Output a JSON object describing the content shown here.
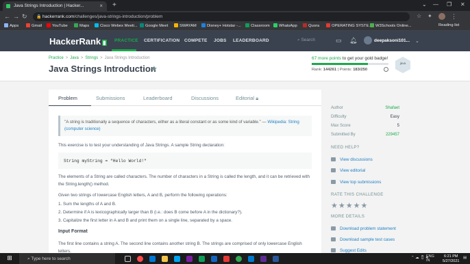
{
  "browser": {
    "tab_title": "Java Strings Introduction | Hacker...",
    "url_host": "hackerrank.com",
    "url_path": "/challenges/java-strings-introduction/problem",
    "bookmarks": [
      {
        "label": "Apps",
        "color": "#8ab4f8"
      },
      {
        "label": "Gmail",
        "color": "#ea4335"
      },
      {
        "label": "YouTube",
        "color": "#ff0000"
      },
      {
        "label": "Maps",
        "color": "#34a853"
      },
      {
        "label": "Cisco Webex Meeti...",
        "color": "#00bceb"
      },
      {
        "label": "Google Meet",
        "color": "#00897b"
      },
      {
        "label": "SWAYAM",
        "color": "#f4b400"
      },
      {
        "label": "Disney+ Hotstar -...",
        "color": "#1f80e0"
      },
      {
        "label": "Classroom",
        "color": "#0f9d58"
      },
      {
        "label": "WhatsApp",
        "color": "#25d366"
      },
      {
        "label": "Quora",
        "color": "#b92b27"
      },
      {
        "label": "OPERATING SYSTE...",
        "color": "#e53935"
      },
      {
        "label": "W3Schools Online...",
        "color": "#4caf50"
      }
    ],
    "reading_list": "Reading list"
  },
  "nav": {
    "logo": "HackerRank",
    "links": [
      "PRACTICE",
      "CERTIFICATION",
      "COMPETE",
      "JOBS",
      "LEADERBOARD"
    ],
    "search_placeholder": "Search",
    "username": "deepaksoni101..."
  },
  "header": {
    "breadcrumb": [
      "Practice",
      "Java",
      "Strings",
      "Java Strings Introduction"
    ],
    "title": "Java Strings Introduction",
    "points_more": "67 more points",
    "points_rest": " to get your gold badge!",
    "progress": 0.73,
    "rank_label": "Rank: ",
    "rank": "144261",
    "points_label": "Points: ",
    "points": "183/250",
    "badge_text": "java"
  },
  "tabs": [
    "Problem",
    "Submissions",
    "Leaderboard",
    "Discussions",
    "Editorial"
  ],
  "problem": {
    "quote_text": "\"A string is traditionally a sequence of characters, either as a literal constant or as some kind of variable.\" — ",
    "quote_link": "Wikipedia: String (computer science)",
    "intro": "This exercise is to test your understanding of Java Strings. A sample String declaration:",
    "code": "String myString = \"Hello World!\"",
    "para1": "The elements of a String are called characters. The number of characters in a String is called the length, and it can be retrieved with the String.length() method.",
    "para2": "Given two strings of lowercase English letters, A and B, perform the following operations:",
    "ops": [
      "1. Sum the lengths of A and B.",
      "2. Determine if A is lexicographically larger than B (i.e.: does B come before A in the dictionary?).",
      "3. Capitalize the first letter in A and B and print them on a single line, separated by a space."
    ],
    "input_heading": "Input Format",
    "input_text": "The first line contains a string A. The second line contains another string B. The strings are comprised of only lowercase English letters."
  },
  "sidebar": {
    "rows": [
      {
        "label": "Author",
        "value": "Shafaet"
      },
      {
        "label": "Difficulty",
        "value": "Easy"
      },
      {
        "label": "Max Score",
        "value": "5"
      },
      {
        "label": "Submitted By",
        "value": "229457"
      }
    ],
    "need_help": "NEED HELP?",
    "help_links": [
      "View discussions",
      "View editorial",
      "View top submissions"
    ],
    "rate": "RATE THIS CHALLENGE",
    "more": "MORE DETAILS",
    "more_links": [
      "Download problem statement",
      "Download sample test cases",
      "Suggest Edits"
    ]
  },
  "taskbar": {
    "search": "Type here to search",
    "lang": "ENG",
    "region": "IN",
    "time": "6:21 PM",
    "date": "5/27/2021"
  }
}
